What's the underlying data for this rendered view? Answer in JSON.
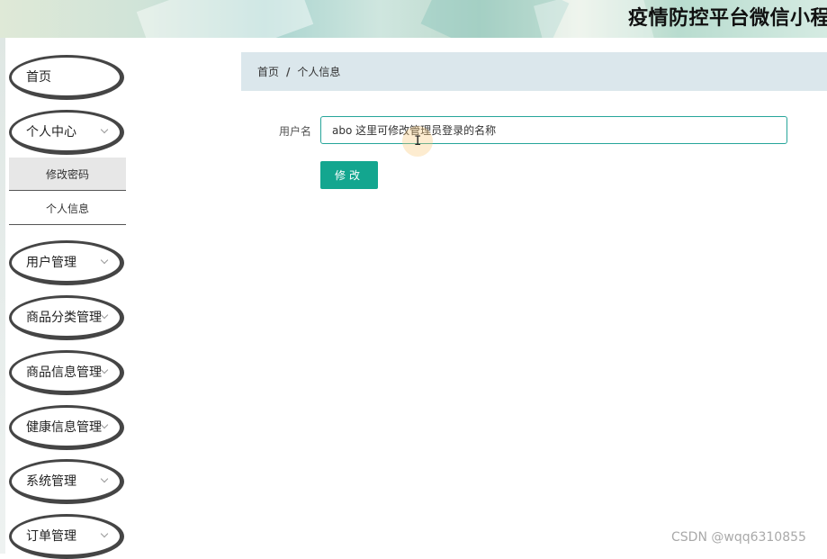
{
  "header": {
    "title": "疫情防控平台微信小程"
  },
  "sidebar": {
    "home": "首页",
    "personal_center": "个人中心",
    "sub_items": [
      "修改密码",
      "个人信息"
    ],
    "menus": [
      "用户管理",
      "商品分类管理",
      "商品信息管理",
      "健康信息管理",
      "系统管理",
      "订单管理"
    ]
  },
  "breadcrumb": {
    "home": "首页",
    "separator": "/",
    "current": "个人信息"
  },
  "form": {
    "username_label": "用户名",
    "username_value": "abo 这里可修改管理员登录的名称",
    "submit_label": "修改"
  },
  "watermark": "CSDN @wqq6310855",
  "colors": {
    "accent": "#13a68f",
    "breadcrumb_bg": "#dbe7ec",
    "input_border": "#27a59a"
  }
}
